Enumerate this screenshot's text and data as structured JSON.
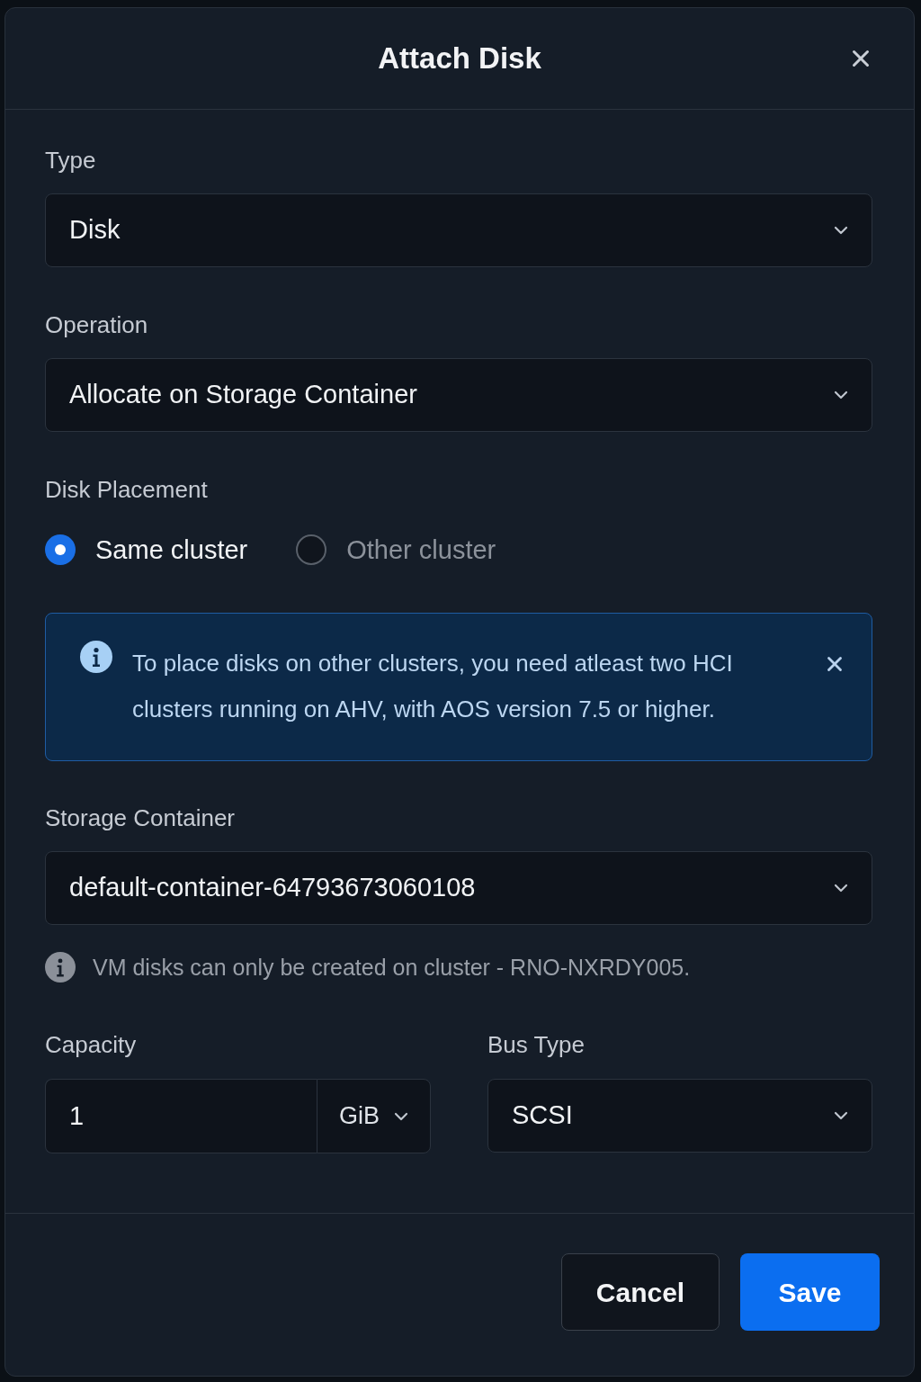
{
  "dialog": {
    "title": "Attach Disk"
  },
  "type_field": {
    "label": "Type",
    "value": "Disk"
  },
  "operation_field": {
    "label": "Operation",
    "value": "Allocate on Storage Container"
  },
  "disk_placement": {
    "label": "Disk Placement",
    "options": [
      {
        "label": "Same cluster",
        "selected": true
      },
      {
        "label": "Other cluster",
        "selected": false
      }
    ]
  },
  "info_banner": {
    "text": "To place disks on other clusters, you need atleast two HCI clusters running on AHV, with AOS version 7.5 or higher."
  },
  "storage_container_field": {
    "label": "Storage Container",
    "value": "default-container-64793673060108"
  },
  "hint": {
    "text": "VM disks can only be created on cluster - RNO-NXRDY005."
  },
  "capacity_field": {
    "label": "Capacity",
    "value": "1",
    "unit": "GiB"
  },
  "bus_type_field": {
    "label": "Bus Type",
    "value": "SCSI"
  },
  "buttons": [
    {
      "label": "Cancel",
      "kind": "secondary"
    },
    {
      "label": "Save",
      "kind": "primary"
    }
  ]
}
